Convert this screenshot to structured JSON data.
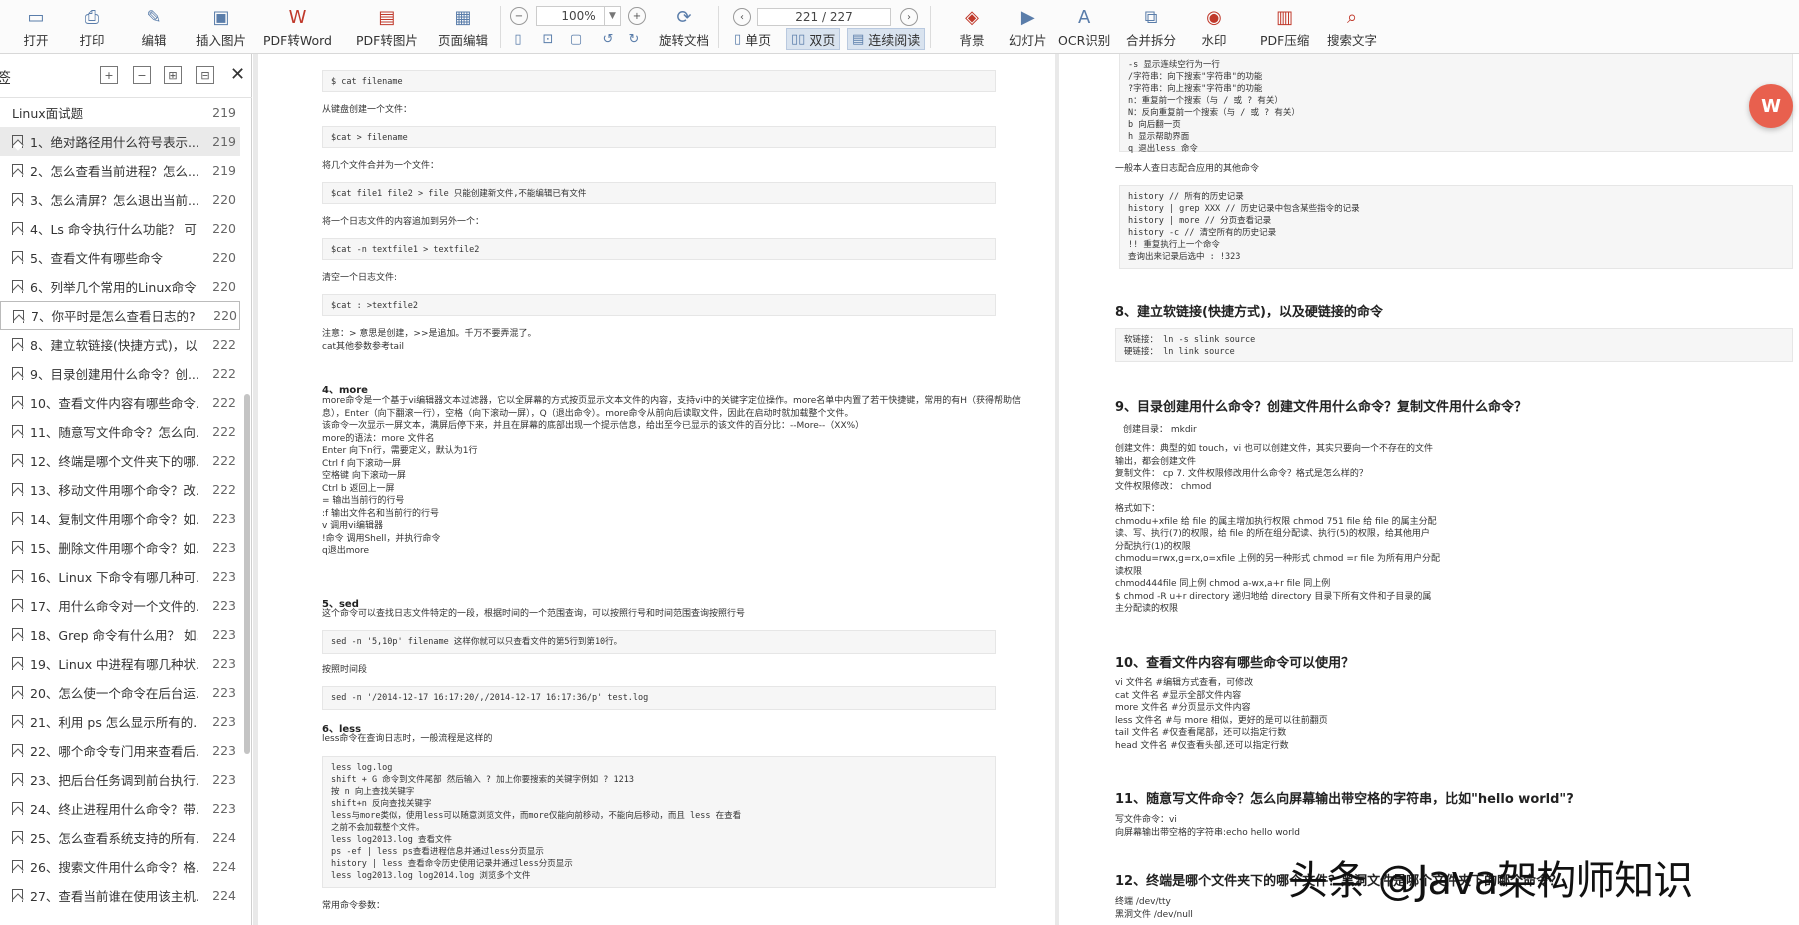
{
  "toolbar": {
    "open": "打开",
    "print": "打印",
    "edit": "编辑",
    "insert_image": "插入图片",
    "pdf_to_word": "PDF转Word",
    "pdf_to_image": "PDF转图片",
    "page_edit": "页面编辑",
    "zoom": "100%",
    "page_indicator": "221 / 227",
    "rotate": "旋转文档",
    "single": "单页",
    "double": "双页",
    "continuous": "连续阅读",
    "background": "背景",
    "slideshow": "幻灯片",
    "ocr": "OCR识别",
    "merge_split": "合并拆分",
    "watermark": "水印",
    "compress": "PDF压缩",
    "search": "搜索文字"
  },
  "sidebar": {
    "title": "签",
    "toc": [
      {
        "title": "Linux面试题",
        "page": "219"
      },
      {
        "title": "1、绝对路径用什么符号表示...",
        "page": "219"
      },
      {
        "title": "2、怎么查看当前进程？怎么...",
        "page": "219"
      },
      {
        "title": "3、怎么清屏？怎么退出当前...",
        "page": "220"
      },
      {
        "title": "4、Ls 命令执行什么功能？ 可...",
        "page": "220"
      },
      {
        "title": "5、查看文件有哪些命令",
        "page": "220"
      },
      {
        "title": "6、列举几个常用的Linux命令",
        "page": "220"
      },
      {
        "title": "7、你平时是怎么查看日志的?",
        "page": "220"
      },
      {
        "title": "8、建立软链接(快捷方式)，以...",
        "page": "222"
      },
      {
        "title": "9、目录创建用什么命令？创...",
        "page": "222"
      },
      {
        "title": "10、查看文件内容有哪些命令...",
        "page": "222"
      },
      {
        "title": "11、随意写文件命令？怎么向...",
        "page": "222"
      },
      {
        "title": "12、终端是哪个文件夹下的哪...",
        "page": "222"
      },
      {
        "title": "13、移动文件用哪个命令？改...",
        "page": "222"
      },
      {
        "title": "14、复制文件用哪个命令？如...",
        "page": "223"
      },
      {
        "title": "15、删除文件用哪个命令？如...",
        "page": "223"
      },
      {
        "title": "16、Linux 下命令有哪几种可...",
        "page": "223"
      },
      {
        "title": "17、用什么命令对一个文件的...",
        "page": "223"
      },
      {
        "title": "18、Grep 命令有什么用？ 如...",
        "page": "223"
      },
      {
        "title": "19、Linux 中进程有哪几种状...",
        "page": "223"
      },
      {
        "title": "20、怎么使一个命令在后台运...",
        "page": "223"
      },
      {
        "title": "21、利用 ps 怎么显示所有的...",
        "page": "223"
      },
      {
        "title": "22、哪个命令专门用来查看后...",
        "page": "223"
      },
      {
        "title": "23、把后台任务调到前台执行...",
        "page": "223"
      },
      {
        "title": "24、终止进程用什么命令？带...",
        "page": "223"
      },
      {
        "title": "25、怎么查看系统支持的所有...",
        "page": "224"
      },
      {
        "title": "26、搜索文件用什么命令？格...",
        "page": "224"
      },
      {
        "title": "27、查看当前谁在使用该主机...",
        "page": "224"
      }
    ]
  },
  "page_left": {
    "c1": "$ cat filename",
    "t1": "从键盘创建一个文件：",
    "c2": "$cat > filename",
    "t2": "将几个文件合并为一个文件：",
    "c3": "$cat file1 file2 > file 只能创建新文件,不能编辑已有文件",
    "t3": "将一个日志文件的内容追加到另外一个：",
    "c4": "$cat -n textfile1 > textfile2",
    "t4": "清空一个日志文件:",
    "c5": "$cat : >textfile2",
    "t5": "注意：> 意思是创建，>>是追加。千万不要弄混了。\ncat其他参数参考tail",
    "h_more": "4、more",
    "more_body": "more命令是一个基于vi编辑器文本过滤器，它以全屏幕的方式按页显示文本文件的内容，支持vi中的关键字定位操作。more名单中内置了若干快捷键，常用的有H（获得帮助信\n息），Enter（向下翻滚一行），空格（向下滚动一屏），Q（退出命令）。more命令从前向后读取文件，因此在启动时就加载整个文件。\n该命令一次显示一屏文本，满屏后停下来，并且在屏幕的底部出现一个提示信息，给出至今已显示的该文件的百分比：--More--（XX%）\nmore的语法：more 文件名\nEnter 向下n行，需要定义，默认为1行\nCtrl f 向下滚动一屏\n空格键 向下滚动一屏\nCtrl b 返回上一屏\n= 输出当前行的行号\n:f 输出文件名和当前行的行号\nv 调用vi编辑器\n!命令 调用Shell，并执行命令\nq退出more",
    "h_sed": "5、sed",
    "sed_body": "这个命令可以查找日志文件特定的一段，根据时间的一个范围查询，可以按照行号和时间范围查询按照行号",
    "c6": "sed -n '5,10p' filename 这样你就可以只查看文件的第5行到第10行。",
    "t6": "按照时间段",
    "c7": "sed -n '/2014-12-17 16:17:20/,/2014-12-17 16:17:36/p' test.log",
    "h_less": "6、less",
    "less_body": "less命令在查询日志时，一般流程是这样的",
    "c8": "less log.log\nshift + G 命令到文件尾部 然后输入 ? 加上你要搜索的关键字例如 ? 1213\n按 n 向上查找关键字\nshift+n 反向查找关键字\nless与more类似，使用less可以随意浏览文件，而more仅能向前移动，不能向后移动，而且 less 在查看\n之前不会加载整个文件。\nless log2013.log 查看文件\nps -ef | less ps查看进程信息并通过less分页显示\nhistory | less 查看命令历史使用记录并通过less分页显示\nless log2013.log log2014.log 浏览多个文件",
    "t7": "常用命令参数："
  },
  "page_right": {
    "c1": "-s 显示连续空行为一行\n/字符串：向下搜索\"字符串\"的功能\n?字符串：向上搜索\"字符串\"的功能\nn：重复前一个搜索（与 / 或 ? 有关）\nN：反向重复前一个搜索（与 / 或 ? 有关）\nb 向后翻一页\nh 显示帮助界面\nq 退出less 命令",
    "t1": "一般本人查日志配合应用的其他命令",
    "c2": "history // 所有的历史记录\nhistory | grep XXX // 历史记录中包含某些指令的记录\nhistory | more // 分页查看记录\nhistory -c // 清空所有的历史记录\n!! 重复执行上一个命令\n查询出来记录后选中 : !323",
    "h8": "8、建立软链接(快捷方式)，以及硬链接的命令",
    "c3": "软链接： ln -s slink source\n硬链接： ln link source",
    "h9": "9、目录创建用什么命令？创建文件用什么命令？复制文件用什么命令？",
    "t9a": "创建目录： mkdir",
    "t9b": "创建文件：典型的如 touch，vi 也可以创建文件，其实只要向一个不存在的文件\n输出，都会创建文件\n复制文件： cp 7. 文件权限修改用什么命令？格式是怎么样的？\n文件权限修改： chmod",
    "t9c": "格式如下：\nchmodu+xfile 给 file 的属主增加执行权限 chmod 751 file 给 file 的属主分配\n读、写、执行(7)的权限，给 file 的所在组分配读、执行(5)的权限，给其他用户\n分配执行(1)的权限\nchmodu=rwx,g=rx,o=xfile 上例的另一种形式 chmod =r file 为所有用户分配\n读权限\nchmod444file 同上例 chmod a-wx,a+r file 同上例\n$ chmod -R u+r directory 递归地给 directory 目录下所有文件和子目录的属\n主分配读的权限",
    "h10": "10、查看文件内容有哪些命令可以使用？",
    "t10": "vi 文件名 #编辑方式查看，可修改\ncat 文件名 #显示全部文件内容\nmore 文件名 #分页显示文件内容\nless 文件名 #与 more 相似，更好的是可以往前翻页\ntail 文件名 #仅查看尾部，还可以指定行数\nhead 文件名 #仅查看头部,还可以指定行数",
    "h11": "11、随意写文件命令？怎么向屏幕输出带空格的字符串，比如\"hello world\"?",
    "t11": "写文件命令：vi\n向屏幕输出带空格的字符串:echo hello world",
    "h12": "12、终端是哪个文件夹下的哪个文件？黑洞文件是哪个文件夹下的哪个命令？",
    "t12": "终端 /dev/tty\n黑洞文件 /dev/null"
  },
  "watermark": "头条 @Java架构师知识"
}
